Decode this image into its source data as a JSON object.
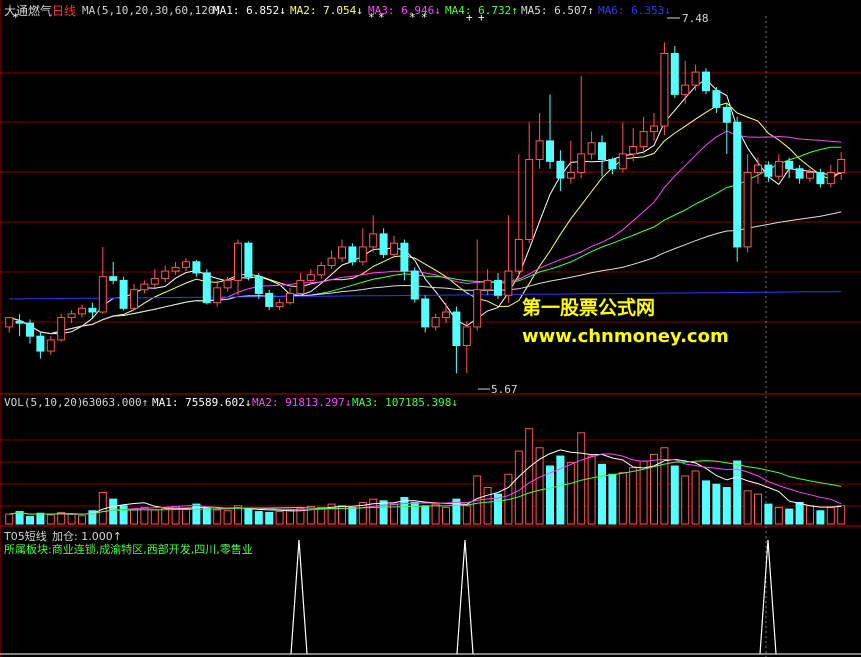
{
  "price_header": {
    "stock": "大通燃气",
    "period": "日线",
    "ma_spec": "MA(5,10,20,30,60,120)",
    "ma1": "MA1: 6.852↓",
    "ma2": "MA2: 7.054↓",
    "ma3": "MA3: 6.946↓",
    "ma4": "MA4: 6.732↑",
    "ma5": "MA5: 6.507↑",
    "ma6": "MA6: 6.353↓"
  },
  "volume_header": {
    "spec": "VOL(5,10,20)",
    "vol": "63063.000↑",
    "ma1": "MA1: 75589.602↓",
    "ma2": "MA2: 91813.297↓",
    "ma3": "MA3: 107185.398↓"
  },
  "indicator_header": {
    "name": "T05短线",
    "value": "加仓: 1.000↑",
    "sector": "所属板块:商业连锁,成渝特区,西部开发,四川,零售业"
  },
  "annotations": {
    "high": "7.48",
    "low": "5.67"
  },
  "watermark": {
    "line1": "第一股票公式网",
    "line2": "www.chnmoney.com"
  },
  "colors": {
    "up": "#ff5555",
    "down": "#55ffff",
    "grid": "#800000",
    "ma1": "#ffffff",
    "ma2": "#ffff66",
    "ma3": "#ff44ff",
    "ma4": "#44ff44",
    "ma5": "#dddddd",
    "ma6": "#3333ff"
  },
  "chart_data": {
    "type": "candlestick",
    "price_range": [
      5.6,
      7.6
    ],
    "candles": [
      [
        5.95,
        6.0,
        5.92,
        5.98
      ],
      [
        5.98,
        5.97,
        5.9,
        6.02
      ],
      [
        5.97,
        5.9,
        5.86,
        5.99
      ],
      [
        5.9,
        5.82,
        5.78,
        5.92
      ],
      [
        5.82,
        5.88,
        5.8,
        5.9
      ],
      [
        5.88,
        6.0,
        5.87,
        6.02
      ],
      [
        6.0,
        6.02,
        5.97,
        6.04
      ],
      [
        6.02,
        6.05,
        6.0,
        6.07
      ],
      [
        6.05,
        6.03,
        6.0,
        6.08
      ],
      [
        6.03,
        6.22,
        6.02,
        6.38
      ],
      [
        6.22,
        6.2,
        6.18,
        6.3
      ],
      [
        6.2,
        6.05,
        6.04,
        6.22
      ],
      [
        6.05,
        6.15,
        6.04,
        6.18
      ],
      [
        6.15,
        6.18,
        6.13,
        6.2
      ],
      [
        6.18,
        6.21,
        6.16,
        6.26
      ],
      [
        6.21,
        6.25,
        6.19,
        6.28
      ],
      [
        6.25,
        6.27,
        6.23,
        6.3
      ],
      [
        6.27,
        6.3,
        6.25,
        6.32
      ],
      [
        6.3,
        6.24,
        6.22,
        6.31
      ],
      [
        6.24,
        6.08,
        6.07,
        6.26
      ],
      [
        6.08,
        6.16,
        6.06,
        6.2
      ],
      [
        6.16,
        6.2,
        6.14,
        6.22
      ],
      [
        6.2,
        6.4,
        6.12,
        6.42
      ],
      [
        6.4,
        6.22,
        6.2,
        6.41
      ],
      [
        6.22,
        6.13,
        6.1,
        6.24
      ],
      [
        6.13,
        6.06,
        6.04,
        6.15
      ],
      [
        6.06,
        6.08,
        6.04,
        6.1
      ],
      [
        6.08,
        6.13,
        6.07,
        6.16
      ],
      [
        6.13,
        6.2,
        6.12,
        6.24
      ],
      [
        6.2,
        6.23,
        6.18,
        6.26
      ],
      [
        6.23,
        6.28,
        6.21,
        6.3
      ],
      [
        6.28,
        6.32,
        6.26,
        6.36
      ],
      [
        6.32,
        6.38,
        6.3,
        6.42
      ],
      [
        6.38,
        6.3,
        6.28,
        6.4
      ],
      [
        6.3,
        6.38,
        6.28,
        6.48
      ],
      [
        6.38,
        6.45,
        6.35,
        6.55
      ],
      [
        6.45,
        6.34,
        6.32,
        6.48
      ],
      [
        6.34,
        6.4,
        6.32,
        6.44
      ],
      [
        6.4,
        6.25,
        6.2,
        6.42
      ],
      [
        6.25,
        6.1,
        6.08,
        6.27
      ],
      [
        6.1,
        5.95,
        5.92,
        6.12
      ],
      [
        5.95,
        6.0,
        5.93,
        6.02
      ],
      [
        6.0,
        6.03,
        5.97,
        6.08
      ],
      [
        6.03,
        5.85,
        5.7,
        6.06
      ],
      [
        5.85,
        5.95,
        5.7,
        5.98
      ],
      [
        5.95,
        6.15,
        5.93,
        6.42
      ],
      [
        6.15,
        6.2,
        6.12,
        6.26
      ],
      [
        6.2,
        6.12,
        6.1,
        6.24
      ],
      [
        6.12,
        6.25,
        6.08,
        6.55
      ],
      [
        6.25,
        6.42,
        6.2,
        6.88
      ],
      [
        6.42,
        6.85,
        6.4,
        7.05
      ],
      [
        6.85,
        6.95,
        6.8,
        7.1
      ],
      [
        6.95,
        6.84,
        6.8,
        7.2
      ],
      [
        6.84,
        6.75,
        6.68,
        6.9
      ],
      [
        6.75,
        6.78,
        6.72,
        6.95
      ],
      [
        6.78,
        6.88,
        6.75,
        7.3
      ],
      [
        6.88,
        6.94,
        6.85,
        7.0
      ],
      [
        6.94,
        6.85,
        6.76,
        6.98
      ],
      [
        6.85,
        6.8,
        6.77,
        6.86
      ],
      [
        6.8,
        6.88,
        6.78,
        7.05
      ],
      [
        6.88,
        6.92,
        6.84,
        7.02
      ],
      [
        6.92,
        7.0,
        6.88,
        7.08
      ],
      [
        7.0,
        7.03,
        6.95,
        7.1
      ],
      [
        7.03,
        7.42,
        6.98,
        7.48
      ],
      [
        7.42,
        7.2,
        7.18,
        7.46
      ],
      [
        7.2,
        7.25,
        7.15,
        7.38
      ],
      [
        7.25,
        7.32,
        7.22,
        7.36
      ],
      [
        7.32,
        7.22,
        7.2,
        7.34
      ],
      [
        7.22,
        7.13,
        7.1,
        7.24
      ],
      [
        7.13,
        7.05,
        6.88,
        7.15
      ],
      [
        7.05,
        6.38,
        6.3,
        7.08
      ],
      [
        6.38,
        6.78,
        6.35,
        6.88
      ],
      [
        6.78,
        6.82,
        6.72,
        6.86
      ],
      [
        6.82,
        6.76,
        6.73,
        6.84
      ],
      [
        6.76,
        6.84,
        6.74,
        6.88
      ],
      [
        6.84,
        6.8,
        6.75,
        6.86
      ],
      [
        6.8,
        6.75,
        6.72,
        6.82
      ],
      [
        6.75,
        6.78,
        6.73,
        6.8
      ],
      [
        6.78,
        6.72,
        6.7,
        6.8
      ],
      [
        6.72,
        6.78,
        6.7,
        6.82
      ],
      [
        6.78,
        6.85,
        6.74,
        6.89
      ]
    ],
    "volume_range": [
      0,
      140000
    ],
    "volume": [
      12000,
      15000,
      9000,
      13000,
      11000,
      14000,
      12000,
      10000,
      16000,
      38000,
      30000,
      22000,
      18000,
      20000,
      17000,
      19000,
      21000,
      18000,
      24000,
      20000,
      17000,
      16000,
      22000,
      18000,
      15000,
      14000,
      15000,
      17000,
      19000,
      21000,
      20000,
      24000,
      22000,
      20000,
      26000,
      30000,
      28000,
      24000,
      32000,
      26000,
      22000,
      24000,
      20000,
      30000,
      22000,
      58000,
      44000,
      36000,
      60000,
      88000,
      115000,
      92000,
      70000,
      82000,
      74000,
      110000,
      82000,
      72000,
      60000,
      62000,
      68000,
      76000,
      84000,
      92000,
      70000,
      58000,
      64000,
      52000,
      48000,
      44000,
      76000,
      40000,
      36000,
      24000,
      20000,
      18000,
      26000,
      22000,
      16000,
      20000,
      22000
    ]
  }
}
